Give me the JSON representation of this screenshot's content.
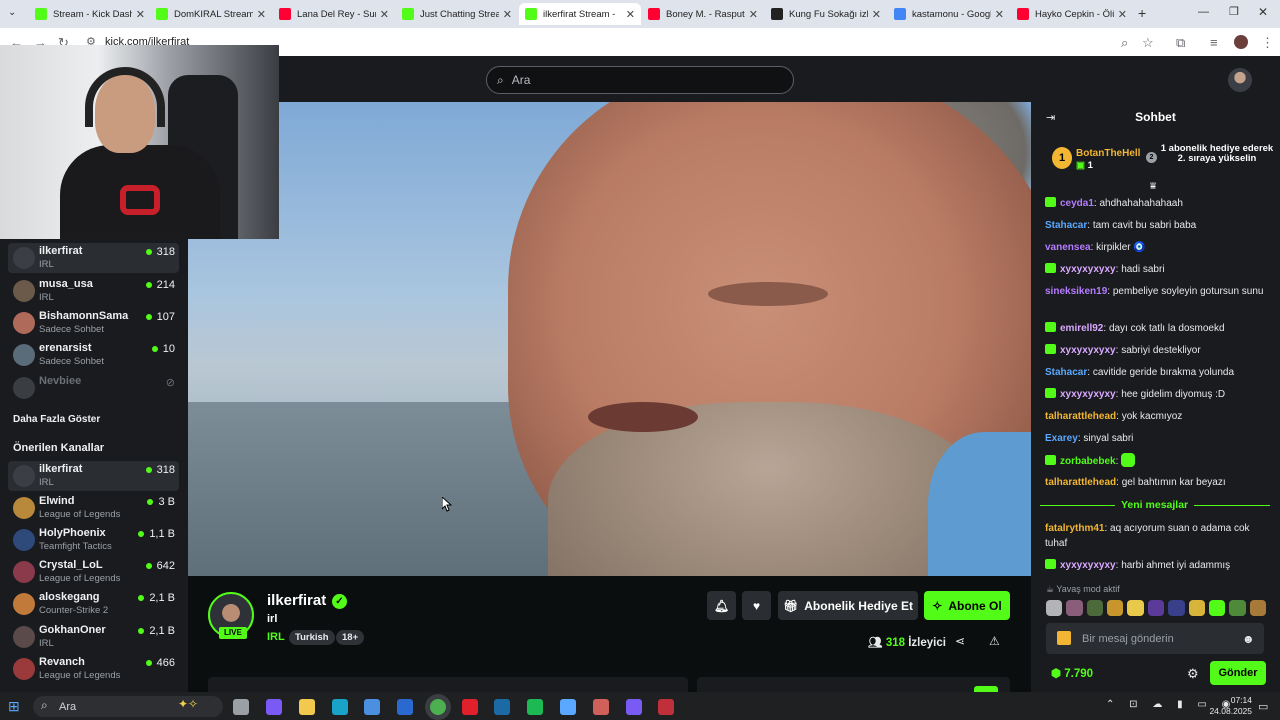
{
  "browser": {
    "url": "kick.com/ilkerfirat",
    "tabs": [
      {
        "title": "Stream - Kick Dashbo",
        "favicon": "kick-icon",
        "color": "#53fc18"
      },
      {
        "title": "DomKIRAL Stream - \\",
        "favicon": "kick-icon",
        "color": "#53fc18"
      },
      {
        "title": "Lana Del Rey - Summ",
        "favicon": "youtube-icon",
        "color": "#ff0033"
      },
      {
        "title": "Just Chatting Stream",
        "favicon": "kick-icon",
        "color": "#53fc18"
      },
      {
        "title": "ilkerfirat Stream -",
        "favicon": "kick-icon",
        "color": "#53fc18",
        "active": true
      },
      {
        "title": "Boney M. - Rasputin",
        "favicon": "youtube-icon",
        "color": "#ff0033"
      },
      {
        "title": "Kung Fu Sokağı izle |",
        "favicon": "site-icon",
        "color": "#222222"
      },
      {
        "title": "kastamonu - Google'",
        "favicon": "google-icon",
        "color": "#4285f4"
      },
      {
        "title": "Hayko Cepkin - Ölüy",
        "favicon": "youtube-icon",
        "color": "#ff0033"
      }
    ]
  },
  "header": {
    "search_placeholder": "Ara"
  },
  "sidebar": {
    "followed": [
      {
        "name": "ilkerfirat",
        "category": "IRL",
        "viewers": "318",
        "active": true
      },
      {
        "name": "musa_usa",
        "category": "IRL",
        "viewers": "214"
      },
      {
        "name": "BishamonnSama",
        "category": "Sadece Sohbet",
        "viewers": "107"
      },
      {
        "name": "erenarsist",
        "category": "Sadece Sohbet",
        "viewers": "10"
      },
      {
        "name": "Nevbiee",
        "category": "",
        "viewers": "",
        "offline": true
      }
    ],
    "show_more": "Daha Fazla Göster",
    "recommended_title": "Önerilen Kanallar",
    "recommended": [
      {
        "name": "ilkerfirat",
        "category": "IRL",
        "viewers": "318",
        "active": true
      },
      {
        "name": "Elwind",
        "category": "League of Legends",
        "viewers": "3 B"
      },
      {
        "name": "HolyPhoenix",
        "category": "Teamfight Tactics",
        "viewers": "1,1 B"
      },
      {
        "name": "Crystal_LoL",
        "category": "League of Legends",
        "viewers": "642"
      },
      {
        "name": "aloskegang",
        "category": "Counter-Strike 2",
        "viewers": "2,1 B"
      },
      {
        "name": "GokhanOner",
        "category": "IRL",
        "viewers": "2,1 B"
      },
      {
        "name": "Revanch",
        "category": "League of Legends",
        "viewers": "466"
      }
    ]
  },
  "stream": {
    "streamer": "ilkerfirat",
    "live_label": "LIVE",
    "title": "irl",
    "category": "IRL",
    "tags": [
      "Turkish",
      "18+"
    ],
    "gift_label": "Abonelik Hediye Et",
    "subscribe_label": "Abone Ol",
    "viewer_count": "318",
    "viewer_label": "İzleyici"
  },
  "chat": {
    "title": "Sohbet",
    "pinned": {
      "rank": "1",
      "user": "BotanTheHell",
      "count": "1",
      "next_rank": "2",
      "message": "1 abonelik hediye ederek 2. sıraya yükselin"
    },
    "messages": [
      {
        "user": "ceyda1",
        "color": "#b57cff",
        "text": "ahdhahahahahaah",
        "badge": true
      },
      {
        "user": "Stahacar",
        "color": "#5aa8ff",
        "text": "tam cavit bu sabri baba"
      },
      {
        "user": "vanensea",
        "color": "#b57cff",
        "text": "kirpikler 🧿"
      },
      {
        "user": "xyxyxyxyxy",
        "color": "#d9a9ff",
        "text": "hadi sabri",
        "badge": true
      },
      {
        "user": "sineksiken19",
        "color": "#b57cff",
        "text": "pembeliye soyleyin gotursun sunu"
      },
      {
        "user": "emirell92",
        "color": "#d9a9ff",
        "text": "dayı cok tatlı la dosmoekd",
        "badge": true
      },
      {
        "user": "xyxyxyxyxy",
        "color": "#d9a9ff",
        "text": "sabriyi destekliyor",
        "badge": true
      },
      {
        "user": "Stahacar",
        "color": "#5aa8ff",
        "text": "cavitide geride bırakma yolunda"
      },
      {
        "user": "xyxyxyxyxy",
        "color": "#d9a9ff",
        "text": "hee gidelim diyomuş :D",
        "badge": true
      },
      {
        "user": "talharattlehead",
        "color": "#f2b632",
        "text": "yok kacmıyoz"
      },
      {
        "user": "Exarey",
        "color": "#5aa8ff",
        "text": "sinyal sabri"
      },
      {
        "user": "zorbabebek",
        "color": "#53fc18",
        "text": "",
        "badge": true
      },
      {
        "user": "talharattlehead",
        "color": "#f2b632",
        "text": "gel bahtımın kar beyazı"
      }
    ],
    "new_messages_label": "Yeni mesajlar",
    "new_messages": [
      {
        "user": "fatalrythm41",
        "color": "#f2b632",
        "text": "aq acıyorum suan o adama cok tuhaf"
      },
      {
        "user": "xyxyxyxyxy",
        "color": "#d9a9ff",
        "text": "harbi ahmet iyi adammış",
        "badge": true
      }
    ],
    "slow_mode": "Yavaş mod aktif",
    "input_placeholder": "Bir mesaj gönderin",
    "points": "7.790",
    "send_label": "Gönder"
  },
  "taskbar": {
    "search_placeholder": "Ara",
    "time": "07:14",
    "date": "24.08.2025"
  }
}
